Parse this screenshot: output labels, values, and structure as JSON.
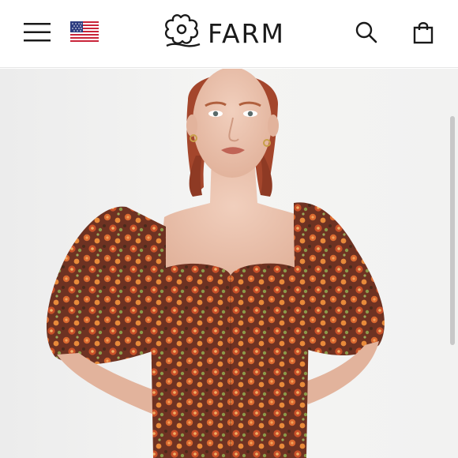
{
  "header": {
    "logo_text": "FARM",
    "icons": {
      "menu": "hamburger-menu-icon",
      "flag": "us-flag-icon",
      "logo": "flower-logo-icon",
      "search": "search-icon",
      "bag": "shopping-bag-icon"
    }
  },
  "colors": {
    "header_bg": "#ffffff",
    "icon": "#1a1a1a",
    "hero_bg": "#f1f1f0",
    "dress_base": "#6e3222",
    "flower_orange": "#d9682f",
    "hair": "#a4462c"
  },
  "hero": {
    "image": "product-model-photo"
  }
}
